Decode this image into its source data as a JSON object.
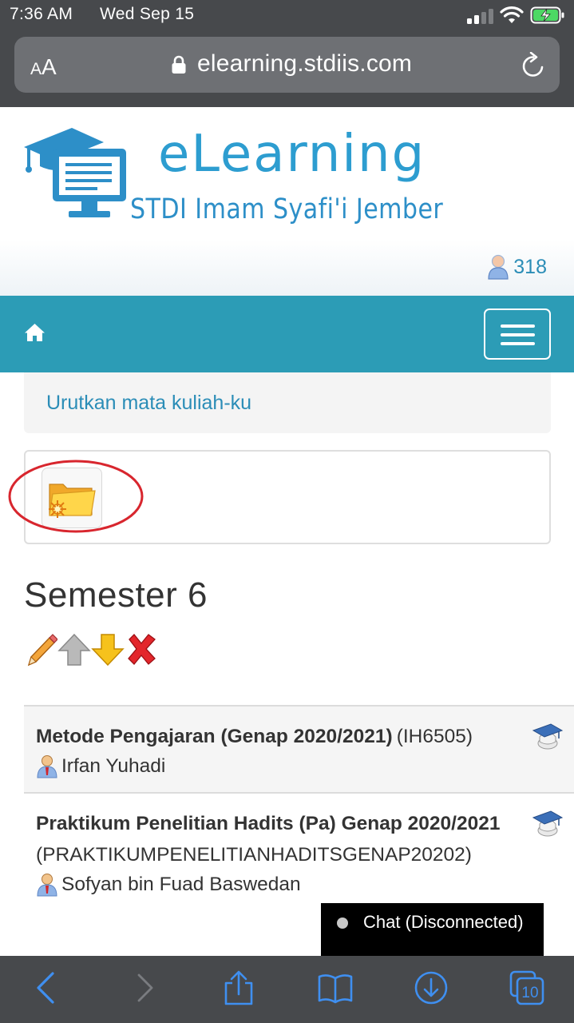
{
  "status_bar": {
    "time": "7:36 AM",
    "date": "Wed Sep 15"
  },
  "address_bar": {
    "text_size_small": "A",
    "text_size_big": "A",
    "url": "elearning.stdiis.com"
  },
  "header": {
    "brand_title": "eLearning",
    "brand_subtitle": "STDI Imam Syafi'i Jember",
    "online_users_count": "318"
  },
  "navbar": {
    "home_icon": "home-icon",
    "menu_icon": "hamburger-icon"
  },
  "content": {
    "sort_link": "Urutkan mata kuliah-ku",
    "folder_icon": "new-folder-icon",
    "semester_title": "Semester 6",
    "semester_actions": [
      "edit-pencil-icon",
      "move-up-arrow-icon",
      "move-down-arrow-icon",
      "delete-x-icon"
    ],
    "courses": [
      {
        "name": "Metode Pengajaran (Genap 2020/2021)",
        "code": "(IH6505)",
        "teacher": "Irfan Yuhadi"
      },
      {
        "name": "Praktikum Penelitian Hadits (Pa) Genap 2020/2021",
        "code": "(PRAKTIKUMPENELITIANHADITSGENAP20202)",
        "teacher": "Sofyan bin Fuad Baswedan"
      }
    ]
  },
  "chat": {
    "label": "Chat (Disconnected)"
  },
  "toolbar": {
    "tab_count": "10"
  },
  "colors": {
    "navbar": "#2c9cb6",
    "link": "#2b8db7",
    "brand": "#2d9dd0",
    "chrome": "#47494c",
    "ios_blue": "#3f8ff0"
  }
}
